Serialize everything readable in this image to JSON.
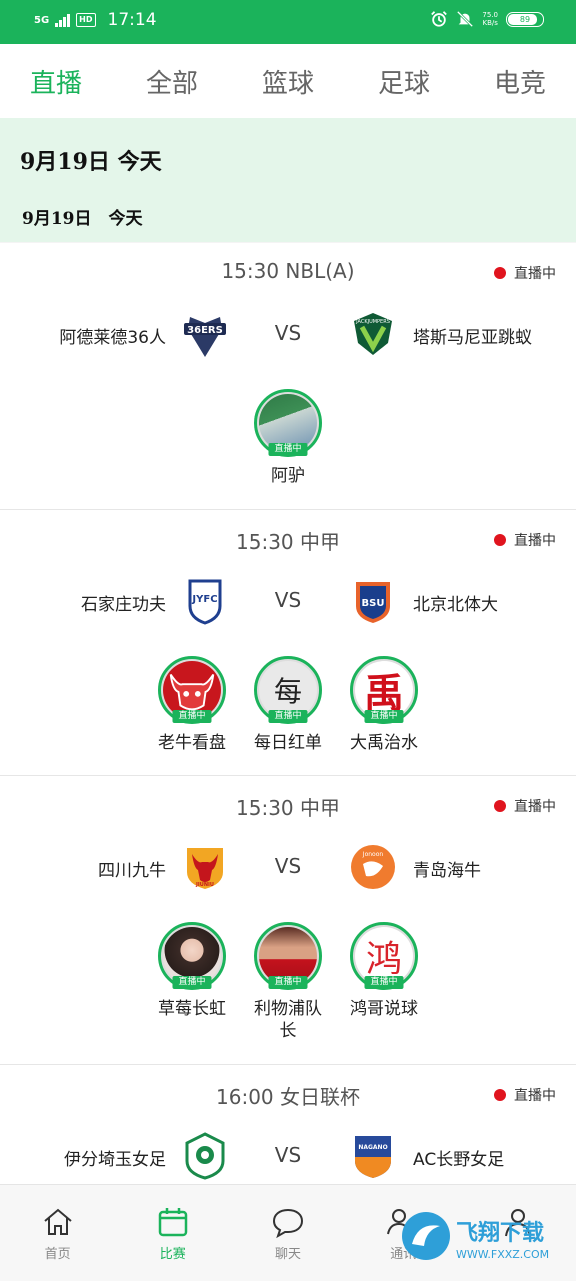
{
  "status_bar": {
    "network": "5G",
    "hd": "HD",
    "time": "17:14",
    "speed_value": "75.0",
    "speed_unit": "KB/s",
    "battery": "89"
  },
  "tabs": [
    {
      "label": "直播",
      "active": true
    },
    {
      "label": "全部",
      "active": false
    },
    {
      "label": "篮球",
      "active": false
    },
    {
      "label": "足球",
      "active": false
    },
    {
      "label": "电竞",
      "active": false
    }
  ],
  "date_banner": {
    "main": "9月19日 今天",
    "sub": "9月19日　今天"
  },
  "matches": [
    {
      "time_league": "15:30 NBL(A)",
      "live_label": "直播中",
      "home": "阿德莱德36人",
      "away": "塔斯马尼亚跳蚁",
      "vs": "VS",
      "home_logo_text": "36ERS",
      "away_logo_text": "JACKJUMPERS",
      "anchors": [
        {
          "name": "阿驴",
          "badge": "直播中"
        }
      ]
    },
    {
      "time_league": "15:30 中甲",
      "live_label": "直播中",
      "home": "石家庄功夫",
      "away": "北京北体大",
      "vs": "VS",
      "home_logo_text": "JYFC",
      "away_logo_text": "BSU",
      "anchors": [
        {
          "name": "老牛看盘",
          "badge": "直播中"
        },
        {
          "name": "每日红单",
          "badge": "直播中",
          "glyph": "每"
        },
        {
          "name": "大禹治水",
          "badge": "直播中",
          "glyph": "禹"
        }
      ]
    },
    {
      "time_league": "15:30 中甲",
      "live_label": "直播中",
      "home": "四川九牛",
      "away": "青岛海牛",
      "vs": "VS",
      "home_logo_text": "JIUNIU",
      "away_logo_text": "Jonoon",
      "anchors": [
        {
          "name": "草莓长虹",
          "badge": "直播中"
        },
        {
          "name": "利物浦队长",
          "badge": "直播中"
        },
        {
          "name": "鸿哥说球",
          "badge": "直播中",
          "glyph": "鸿"
        }
      ]
    },
    {
      "time_league": "16:00 女日联杯",
      "live_label": "直播中",
      "home": "伊分埼玉女足",
      "away": "AC长野女足",
      "vs": "VS",
      "home_logo_text": "",
      "away_logo_text": "NAGANO"
    }
  ],
  "bottom_nav": [
    {
      "label": "首页",
      "icon": "home-icon"
    },
    {
      "label": "比赛",
      "icon": "calendar-icon",
      "active": true
    },
    {
      "label": "聊天",
      "icon": "chat-icon"
    },
    {
      "label": "通讯",
      "icon": "contacts-icon"
    },
    {
      "label": "",
      "icon": "profile-icon"
    }
  ],
  "colors": {
    "brand": "#1bb35b",
    "live": "#e0141e",
    "banner": "#e4f6ea"
  },
  "watermark": {
    "text": "飞翔下载",
    "url": "WWW.FXXZ.COM"
  }
}
